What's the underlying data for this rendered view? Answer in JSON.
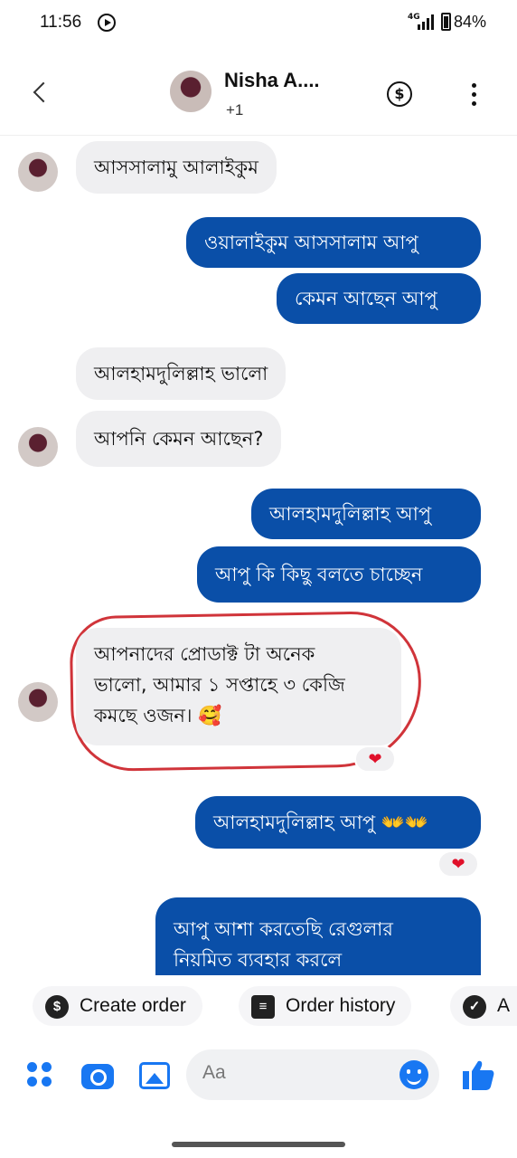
{
  "status_bar": {
    "time": "11:56",
    "network": "4G",
    "battery": "84%",
    "battery_level": 0.84
  },
  "header": {
    "contact_name": "Nisha A....",
    "contact_sub": "+1",
    "icons": [
      "back-arrow-icon",
      "avatar",
      "dollar-icon",
      "more-vertical-icon"
    ]
  },
  "messages": [
    {
      "side": "in",
      "text": "আসসালামু আলাইকুম"
    },
    {
      "side": "out",
      "text": "ওয়ালাইকুম আসসালাম আপু"
    },
    {
      "side": "out",
      "text": "কেমন আছেন আপু"
    },
    {
      "side": "in",
      "text": "আলহামদুলিল্লাহ ভালো"
    },
    {
      "side": "in",
      "text": "আপনি কেমন আছেন?"
    },
    {
      "side": "out",
      "text": "আলহামদুলিল্লাহ আপু"
    },
    {
      "side": "out",
      "text": "আপু কি কিছু বলতে চাচ্ছেন"
    },
    {
      "side": "in",
      "lines": [
        "আপনাদের প্রোডাক্ট টা অনেক",
        "ভালো, আমার ১ সপ্তাহে ৩ কেজি",
        "কমছে ওজন। 🥰"
      ],
      "reaction": "❤"
    },
    {
      "side": "out",
      "text": "আলহামদুলিল্লাহ আপু 👐👐",
      "reaction": "❤"
    },
    {
      "side": "out",
      "lines": [
        "আপু আশা করতেছি রেগুলার",
        "নিয়মিত ব্যবহার করলে"
      ]
    }
  ],
  "quick_actions": [
    {
      "label": "Create order",
      "icon": "dollar-icon"
    },
    {
      "label": "Order history",
      "icon": "list-icon"
    },
    {
      "label": "A",
      "icon": "check-icon"
    }
  ],
  "composer": {
    "placeholder": "Aa",
    "icons": [
      "apps-icon",
      "camera-icon",
      "gallery-icon",
      "emoji-icon",
      "thumbs-up-icon"
    ]
  },
  "colors": {
    "outgoing_bubble": "#0a4fa8",
    "incoming_bubble": "#efeff1",
    "accent": "#1877f2",
    "annotation_circle": "#d0343a",
    "reaction_heart": "#e0102a"
  }
}
